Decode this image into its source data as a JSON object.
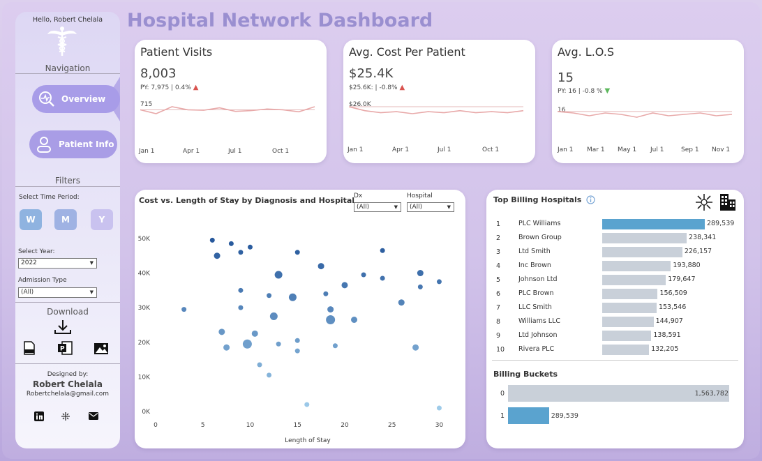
{
  "sidebar": {
    "greeting": "Hello, Robert Chelala",
    "navigation_heading": "Navigation",
    "nav": [
      {
        "label": "Overview",
        "active": true
      },
      {
        "label": "Patient Info",
        "active": false
      }
    ],
    "filters_heading": "Filters",
    "time_period_label": "Select Time Period:",
    "time_buttons": [
      "W",
      "M",
      "Y"
    ],
    "year_label": "Select Year:",
    "year_value": "2022",
    "admission_label": "Admission Type",
    "admission_value": "(All)",
    "download_heading": "Download",
    "download_icons": [
      "download-arrow-icon",
      "pdf-icon",
      "powerpoint-icon",
      "image-icon"
    ],
    "designed_by": "Designed by:",
    "designer_name": "Robert Chelala",
    "designer_email": "Robertchelala@gmail.com",
    "social_icons": [
      "linkedin-icon",
      "tableau-icon",
      "email-icon"
    ]
  },
  "title": "Hospital Network Dashboard",
  "kpis": [
    {
      "title": "Patient Visits",
      "value": "8,003",
      "sub": "PY: 7,975 | 0.4%",
      "trend": "up",
      "ref_label": "715",
      "ticks": [
        "Jan 1",
        "Apr 1",
        "Jul 1",
        "Oct 1"
      ],
      "spark": [
        715,
        690,
        735,
        715,
        712,
        728,
        705,
        710,
        720,
        715,
        702,
        735
      ]
    },
    {
      "title": "Avg. Cost Per Patient",
      "value": "$25.4K",
      "sub": "$25.6K: | -0.8%",
      "trend": "up",
      "ref_label": "$26.0K",
      "ticks": [
        "Jan 1",
        "Apr 1",
        "Jul 1",
        "Oct 1"
      ],
      "spark": [
        26.0,
        25.6,
        25.4,
        25.5,
        25.3,
        25.5,
        25.4,
        25.6,
        25.4,
        25.5,
        25.4,
        25.6
      ]
    },
    {
      "title": "Avg. L.O.S",
      "value": "15",
      "sub": "PY: 16 | -0.8 %",
      "trend": "down",
      "ref_label": "16",
      "ticks": [
        "Jan 1",
        "Mar 1",
        "May 1",
        "Jul 1",
        "Sep 1",
        "Nov 1"
      ],
      "spark": [
        15.6,
        15.5,
        15.3,
        15.5,
        15.4,
        15.2,
        15.5,
        15.3,
        15.4,
        15.5,
        15.3,
        15.4
      ]
    }
  ],
  "scatter": {
    "filters": [
      {
        "label": "Dx",
        "value": "(All)"
      },
      {
        "label": "Hospital",
        "value": "(All)"
      }
    ]
  },
  "chart_data": [
    {
      "type": "scatter",
      "title": "Cost vs. Length of Stay by Diagnosis and Hospital",
      "xlabel": "Length of Stay",
      "ylabel": "",
      "xlim": [
        0,
        31
      ],
      "ylim": [
        0,
        53000
      ],
      "x_ticks": [
        "0",
        "5",
        "10",
        "15",
        "20",
        "25",
        "30"
      ],
      "y_ticks": [
        "0K",
        "10K",
        "20K",
        "30K",
        "40K",
        "50K"
      ],
      "points": [
        {
          "x": 6,
          "y": 49500,
          "s": 3
        },
        {
          "x": 8,
          "y": 48500,
          "s": 3
        },
        {
          "x": 9,
          "y": 46000,
          "s": 3
        },
        {
          "x": 10,
          "y": 47500,
          "s": 3
        },
        {
          "x": 6.5,
          "y": 45000,
          "s": 4
        },
        {
          "x": 15,
          "y": 46000,
          "s": 3
        },
        {
          "x": 24,
          "y": 46500,
          "s": 3
        },
        {
          "x": 17.5,
          "y": 42000,
          "s": 4
        },
        {
          "x": 13,
          "y": 39500,
          "s": 5
        },
        {
          "x": 22,
          "y": 39500,
          "s": 3
        },
        {
          "x": 28,
          "y": 40000,
          "s": 4
        },
        {
          "x": 24,
          "y": 38500,
          "s": 3
        },
        {
          "x": 30,
          "y": 37500,
          "s": 3
        },
        {
          "x": 20,
          "y": 36500,
          "s": 4
        },
        {
          "x": 28,
          "y": 36000,
          "s": 3
        },
        {
          "x": 9,
          "y": 35000,
          "s": 3
        },
        {
          "x": 18,
          "y": 34000,
          "s": 3
        },
        {
          "x": 12,
          "y": 33500,
          "s": 3
        },
        {
          "x": 14.5,
          "y": 33000,
          "s": 5
        },
        {
          "x": 26,
          "y": 31500,
          "s": 4
        },
        {
          "x": 3,
          "y": 29500,
          "s": 3
        },
        {
          "x": 9,
          "y": 30000,
          "s": 3
        },
        {
          "x": 18.5,
          "y": 29500,
          "s": 4
        },
        {
          "x": 12.5,
          "y": 27500,
          "s": 5
        },
        {
          "x": 18.5,
          "y": 26500,
          "s": 6
        },
        {
          "x": 21,
          "y": 26500,
          "s": 4
        },
        {
          "x": 7,
          "y": 23000,
          "s": 4
        },
        {
          "x": 10.5,
          "y": 22500,
          "s": 4
        },
        {
          "x": 15,
          "y": 20500,
          "s": 3
        },
        {
          "x": 13,
          "y": 19500,
          "s": 3
        },
        {
          "x": 9.7,
          "y": 19500,
          "s": 6
        },
        {
          "x": 7.5,
          "y": 18500,
          "s": 4
        },
        {
          "x": 19,
          "y": 19000,
          "s": 3
        },
        {
          "x": 27.5,
          "y": 18500,
          "s": 4
        },
        {
          "x": 15,
          "y": 17500,
          "s": 3
        },
        {
          "x": 11,
          "y": 13500,
          "s": 3
        },
        {
          "x": 12,
          "y": 10500,
          "s": 3
        },
        {
          "x": 16,
          "y": 2000,
          "s": 3
        },
        {
          "x": 30,
          "y": 1000,
          "s": 3
        }
      ]
    },
    {
      "type": "bar",
      "title": "Top Billing Hospitals",
      "categories": [
        "PLC Williams",
        "Brown Group",
        "Ltd Smith",
        "Inc Brown",
        "Johnson Ltd",
        "PLC Brown",
        "LLC Smith",
        "Williams LLC",
        "Ltd Johnson",
        "Rivera PLC"
      ],
      "ranks": [
        "1",
        "2",
        "3",
        "4",
        "5",
        "6",
        "7",
        "8",
        "9",
        "10"
      ],
      "values": [
        289539,
        238341,
        226157,
        193880,
        179647,
        156509,
        153546,
        144907,
        138591,
        132205
      ],
      "labels": [
        "289,539",
        "238,341",
        "226,157",
        "193,880",
        "179,647",
        "156,509",
        "153,546",
        "144,907",
        "138,591",
        "132,205"
      ],
      "highlight_color": "#5aa3cf",
      "bar_color": "#c9d0d9"
    },
    {
      "type": "bar",
      "title": "Billing Buckets",
      "categories": [
        "0",
        "1"
      ],
      "values": [
        1563782,
        289539
      ],
      "labels": [
        "1,563,782",
        "289,539"
      ]
    }
  ],
  "billing_icons": [
    "info-icon",
    "tableau-icon",
    "hospital-building-icon"
  ]
}
